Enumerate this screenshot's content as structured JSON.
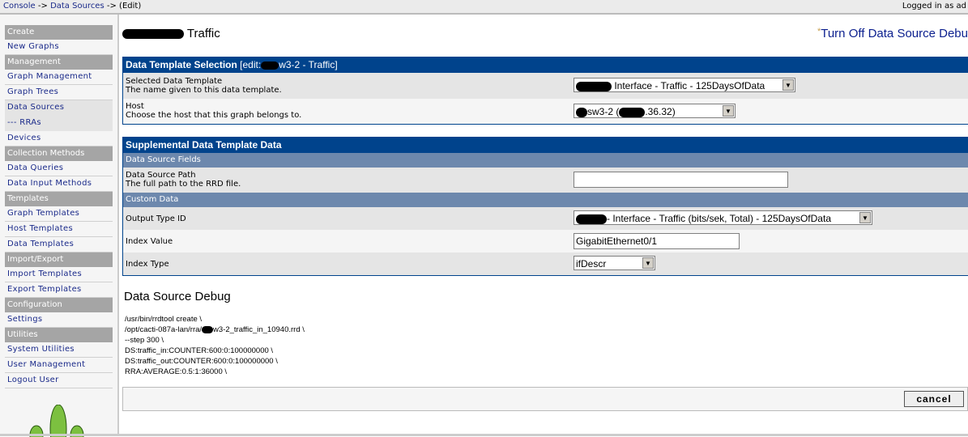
{
  "breadcrumb": {
    "items": [
      "Console",
      "Data Sources",
      "(Edit)"
    ],
    "sep": " -> "
  },
  "login_text": "Logged in as ad",
  "sidebar": [
    {
      "type": "header",
      "label": "Create"
    },
    {
      "type": "item",
      "label": "New Graphs"
    },
    {
      "type": "header",
      "label": "Management"
    },
    {
      "type": "item",
      "label": "Graph Management"
    },
    {
      "type": "item",
      "label": "Graph Trees"
    },
    {
      "type": "item",
      "label": "Data Sources",
      "selected": true
    },
    {
      "type": "item",
      "label": "--- RRAs",
      "selected": true
    },
    {
      "type": "item",
      "label": "Devices"
    },
    {
      "type": "header",
      "label": "Collection Methods"
    },
    {
      "type": "item",
      "label": "Data Queries"
    },
    {
      "type": "item",
      "label": "Data Input Methods"
    },
    {
      "type": "header",
      "label": "Templates"
    },
    {
      "type": "item",
      "label": "Graph Templates"
    },
    {
      "type": "item",
      "label": "Host Templates"
    },
    {
      "type": "item",
      "label": "Data Templates"
    },
    {
      "type": "header",
      "label": "Import/Export"
    },
    {
      "type": "item",
      "label": "Import Templates"
    },
    {
      "type": "item",
      "label": "Export Templates"
    },
    {
      "type": "header",
      "label": "Configuration"
    },
    {
      "type": "item",
      "label": "Settings"
    },
    {
      "type": "header",
      "label": "Utilities"
    },
    {
      "type": "item",
      "label": "System Utilities"
    },
    {
      "type": "item",
      "label": "User Management"
    },
    {
      "type": "item",
      "label": "Logout User"
    }
  ],
  "page": {
    "title": "Traffic",
    "debug_link_star": "*",
    "debug_link": "Turn Off Data Source Debu"
  },
  "template_panel": {
    "title": "Data Template Selection",
    "edit": "[edit:",
    "edit_suffix": "w3-2 - Traffic]",
    "selected_label": "Selected Data Template",
    "selected_desc": "The name given to this data template.",
    "selected_value": "Interface - Traffic - 125DaysOfData",
    "host_label": "Host",
    "host_desc": "Choose the host that this graph belongs to.",
    "host_value_a": "sw3-2 (",
    "host_value_b": ".36.32)"
  },
  "supp_panel": {
    "title": "Supplemental Data Template Data",
    "fields_header": "Data Source Fields",
    "path_label": "Data Source Path",
    "path_desc": "The full path to the RRD file.",
    "path_value": "",
    "custom_header": "Custom Data",
    "output_label": "Output Type ID",
    "output_value": "- Interface - Traffic (bits/sek, Total) - 125DaysOfData",
    "index_value_label": "Index Value",
    "index_value": "GigabitEthernet0/1",
    "index_type_label": "Index Type",
    "index_type": "ifDescr"
  },
  "debug": {
    "title": "Data Source Debug",
    "lines": [
      "/usr/bin/rrdtool create \\",
      "/opt/cacti-087a-lan/rra/",
      "w3-2_traffic_in_10940.rrd \\",
      "--step 300  \\",
      "DS:traffic_in:COUNTER:600:0:100000000 \\",
      "DS:traffic_out:COUNTER:600:0:100000000 \\",
      "RRA:AVERAGE:0.5:1:36000 \\"
    ]
  },
  "buttons": {
    "cancel": "cancel"
  }
}
